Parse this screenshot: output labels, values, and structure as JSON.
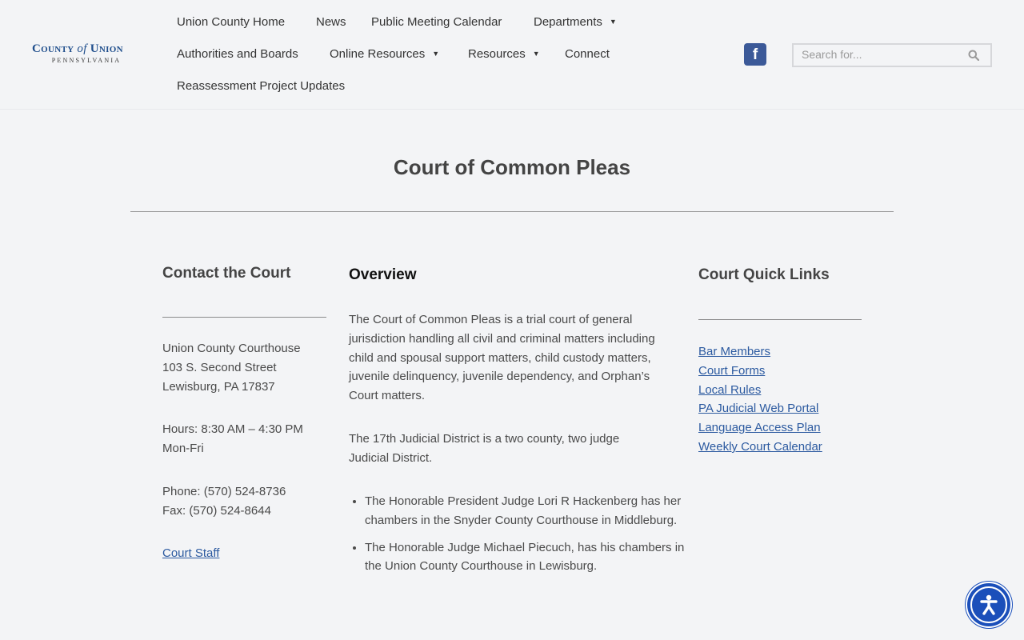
{
  "logo": {
    "county": "County",
    "of": "of",
    "union": "Union",
    "state": "PENNSYLVANIA"
  },
  "nav": {
    "items": [
      {
        "label": "Union County Home"
      },
      {
        "label": "News"
      },
      {
        "label": "Public Meeting Calendar"
      },
      {
        "label": "Departments",
        "has_dropdown": true
      },
      {
        "label": "Authorities and Boards"
      },
      {
        "label": "Online Resources",
        "has_dropdown": true
      },
      {
        "label": "Resources",
        "has_dropdown": true
      },
      {
        "label": "Connect"
      },
      {
        "label": "Reassessment Project Updates"
      }
    ],
    "caret": "▼"
  },
  "social": {
    "facebook": "f"
  },
  "search": {
    "placeholder": "Search for..."
  },
  "page": {
    "title": "Court of Common Pleas"
  },
  "contact": {
    "heading": "Contact the Court",
    "address": [
      "Union County Courthouse",
      "103 S. Second Street",
      "Lewisburg, PA 17837"
    ],
    "hours": [
      "Hours: 8:30 AM – 4:30 PM",
      "Mon-Fri"
    ],
    "phone": "Phone: (570) 524-8736",
    "fax": "Fax: (570) 524-8644",
    "staff_link": "Court Staff"
  },
  "overview": {
    "heading": "Overview",
    "para1": "The Court of Common Pleas is a trial court of general jurisdiction handling all civil and criminal matters including child and spousal support matters, child custody matters, juvenile delinquency, juvenile dependency, and Orphan’s Court matters.",
    "para2": "The 17th Judicial District is a two county, two judge Judicial District.",
    "bullets": [
      "The Honorable President Judge Lori R Hackenberg has her chambers in the Snyder County Courthouse in Middleburg.",
      "The Honorable Judge Michael Piecuch, has his chambers in the Union County Courthouse in Lewisburg."
    ]
  },
  "quick_links": {
    "heading": "Court Quick Links",
    "links": [
      "Bar Members",
      "Court Forms",
      "Local Rules",
      "PA Judicial Web Portal",
      "Language Access Plan",
      "Weekly Court Calendar"
    ]
  },
  "colors": {
    "link": "#2c5aa0",
    "facebook": "#3b5998",
    "accessibility": "#1b4fba"
  }
}
